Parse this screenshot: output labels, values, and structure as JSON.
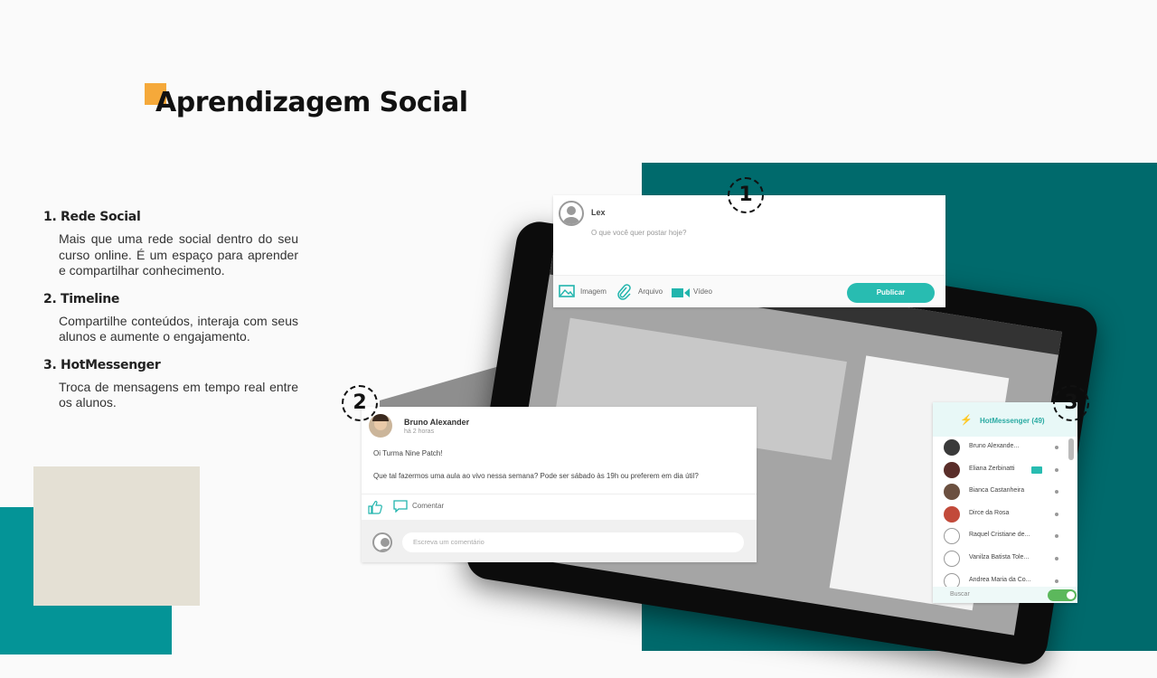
{
  "page": {
    "title": "Aprendizagem Social",
    "accent_color": "#f5a93a",
    "teal_dark": "#006a6c",
    "teal_light": "#049497",
    "beige": "#e4e0d4"
  },
  "features": [
    {
      "heading": "1. Rede Social",
      "text": "Mais que uma rede social dentro do seu curso online. É um espaço para aprender e compartilhar conhecimento."
    },
    {
      "heading": "2. Timeline",
      "text": "Compartilhe conteúdos, interaja com seus alunos e aumente o engajamento."
    },
    {
      "heading": "3. HotMessenger",
      "text": "Troca de mensagens em tempo real entre os alunos."
    }
  ],
  "markers": [
    "1",
    "2",
    "3"
  ],
  "composer": {
    "user": "Lex",
    "placeholder": "O que você quer postar hoje?",
    "image_label": "Imagem",
    "file_label": "Arquivo",
    "video_label": "Vídeo",
    "publish_label": "Publicar",
    "accent": "#28bcb1"
  },
  "post": {
    "author": "Bruno Alexander",
    "time": "há 2 horas",
    "line1": "Oi Turma Nine Patch!",
    "line2": "Que tal fazermos uma aula ao vivo nessa semana? Pode ser sábado às 19h ou preferem em dia útil?",
    "comment_label": "Comentar",
    "comment_placeholder": "Escreva um comentário"
  },
  "messenger": {
    "title": "HotMessenger (49)",
    "contacts": [
      {
        "name": "Bruno Alexande...",
        "avatar": "#3a3a3a"
      },
      {
        "name": "Eliana Zerbinatti",
        "avatar": "#5a2e2a",
        "badge": true
      },
      {
        "name": "Bianca Castanheira",
        "avatar": "#6b5040"
      },
      {
        "name": "Dirce da Rosa",
        "avatar": "#c24a3a"
      },
      {
        "name": "Raquel Cristiane de...",
        "avatar": "gray"
      },
      {
        "name": "Vanilza Batista Tole...",
        "avatar": "gray"
      },
      {
        "name": "Andrea Maria da Co...",
        "avatar": "gray"
      }
    ],
    "search_label": "Buscar"
  }
}
